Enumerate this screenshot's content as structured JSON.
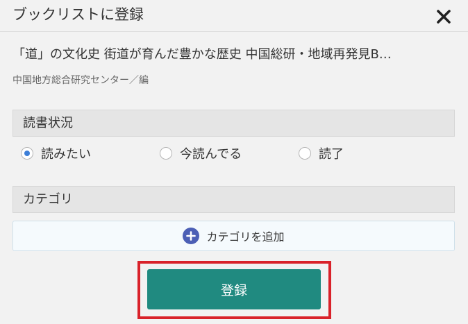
{
  "header": {
    "title": "ブックリストに登録"
  },
  "book": {
    "title": "「道」の文化史 街道が育んだ豊かな歴史 中国総研・地域再発見B…",
    "author": "中国地方総合研究センター／編"
  },
  "reading_status": {
    "label": "読書状況",
    "options": [
      {
        "label": "読みたい",
        "selected": true
      },
      {
        "label": "今読んでる",
        "selected": false
      },
      {
        "label": "読了",
        "selected": false
      }
    ]
  },
  "category": {
    "label": "カテゴリ",
    "add_label": "カテゴリを追加"
  },
  "submit": {
    "label": "登録"
  },
  "colors": {
    "accent": "#208a80",
    "highlight": "#d9222a",
    "radio_selected": "#3d7fd8",
    "add_icon": "#4c5fb5"
  }
}
